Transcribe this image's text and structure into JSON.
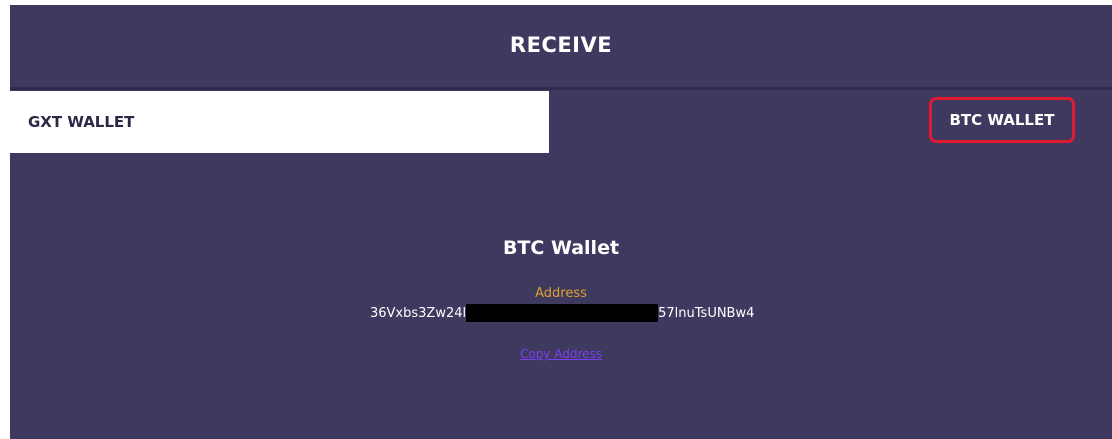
{
  "header": {
    "title": "RECEIVE"
  },
  "tabs": [
    {
      "label": "GXT WALLET",
      "active": true
    },
    {
      "label": "BTC WALLET",
      "active": false,
      "highlighted": true
    }
  ],
  "wallet": {
    "heading": "BTC Wallet",
    "address_label": "Address",
    "address_prefix": "36Vxbs3Zw24l",
    "address_suffix": "57lnuTsUNBw4",
    "copy_label": "Copy Address"
  },
  "colors": {
    "background": "#3e3a5f",
    "active_tab_bg": "#ffffff",
    "highlight_border": "#e01b2e",
    "address_label": "#e0a02c",
    "link": "#7a3ff0"
  }
}
